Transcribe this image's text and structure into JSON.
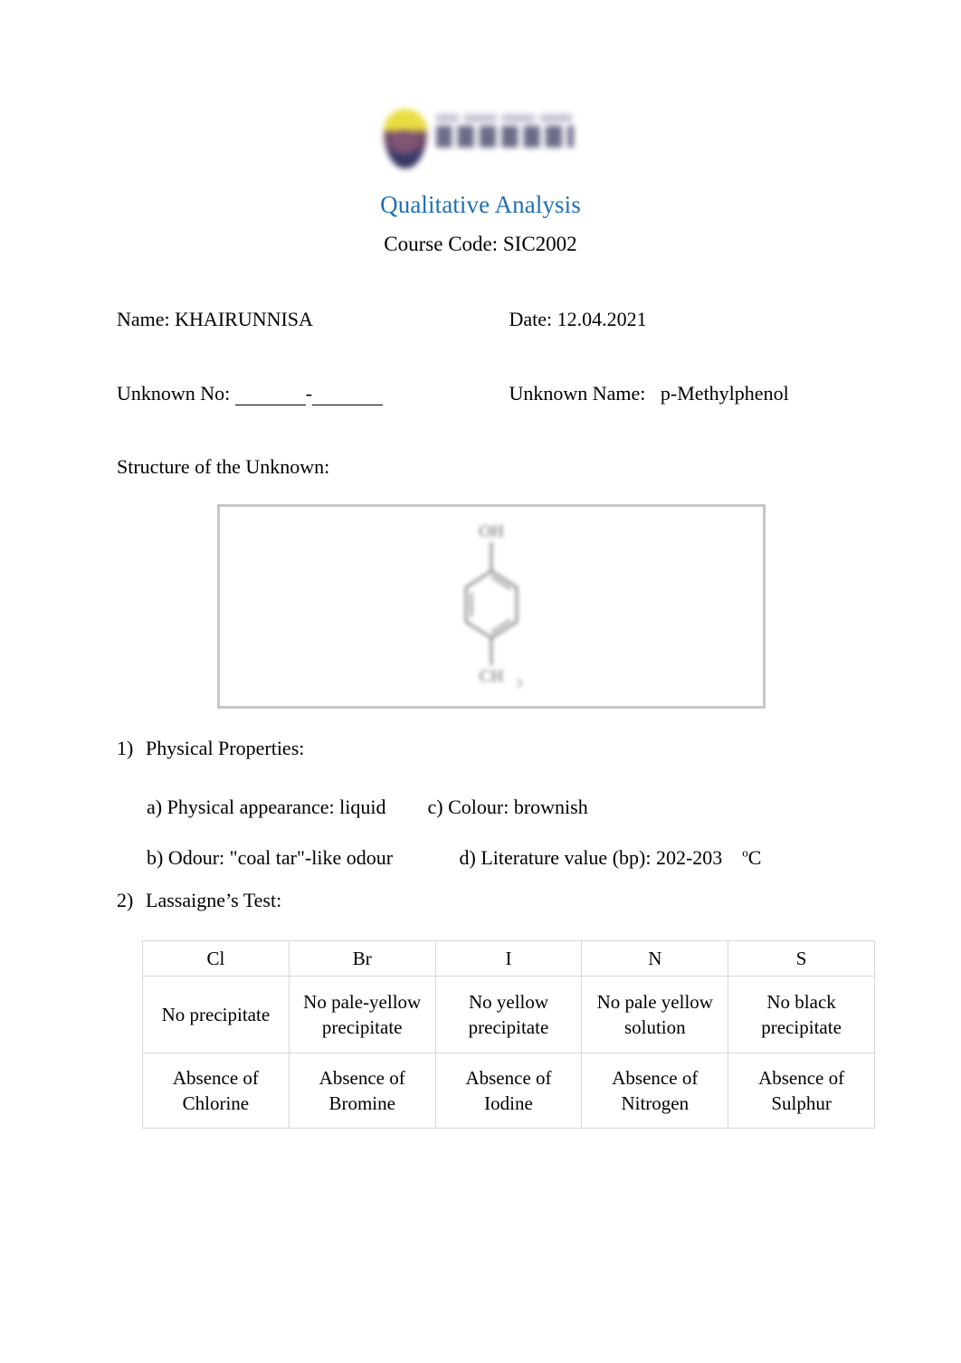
{
  "header": {
    "logo_icon": "university-shield-logo",
    "title": "Qualitative Analysis",
    "title_color": "#1F6FB5",
    "course_code": "Course Code: SIC2002"
  },
  "info": {
    "name_label": "Name:",
    "name_value": "KHAIRUNNISA",
    "date_label": "Date:",
    "date_value": "12.04.2021",
    "unknown_no_label": "Unknown No:",
    "unknown_no_separator": "-",
    "unknown_name_label": "Unknown Name:",
    "unknown_name_value": "p-Methylphenol"
  },
  "structure": {
    "label": "Structure of the Unknown:",
    "image_icon": "p-methylphenol-structure",
    "border_color": "#c7c7c7"
  },
  "sections": [
    {
      "number": "1)",
      "title": "Physical Properties:"
    },
    {
      "number": "2)",
      "title": "Lassaigne’s Test:"
    }
  ],
  "physical_properties": {
    "a_label": "a) Physical appearance:",
    "a_value": "liquid",
    "c_label": "c) Colour:",
    "c_value": "brownish",
    "b_label": "b) Odour:",
    "b_value": "\"coal tar\"-like odour",
    "d_label": "d) Literature value (bp):",
    "d_value": "202-203",
    "d_unit_sup": "o",
    "d_unit": "C"
  },
  "lassaigne_table": {
    "headers": [
      "Cl",
      "Br",
      "I",
      "N",
      "S"
    ],
    "observations": [
      "No precipitate",
      "No pale-yellow precipitate",
      "No yellow precipitate",
      "No pale yellow solution",
      "No black precipitate"
    ],
    "conclusions": [
      "Absence of Chlorine",
      "Absence of Bromine",
      "Absence of Iodine",
      "Absence of Nitrogen",
      "Absence of Sulphur"
    ]
  }
}
